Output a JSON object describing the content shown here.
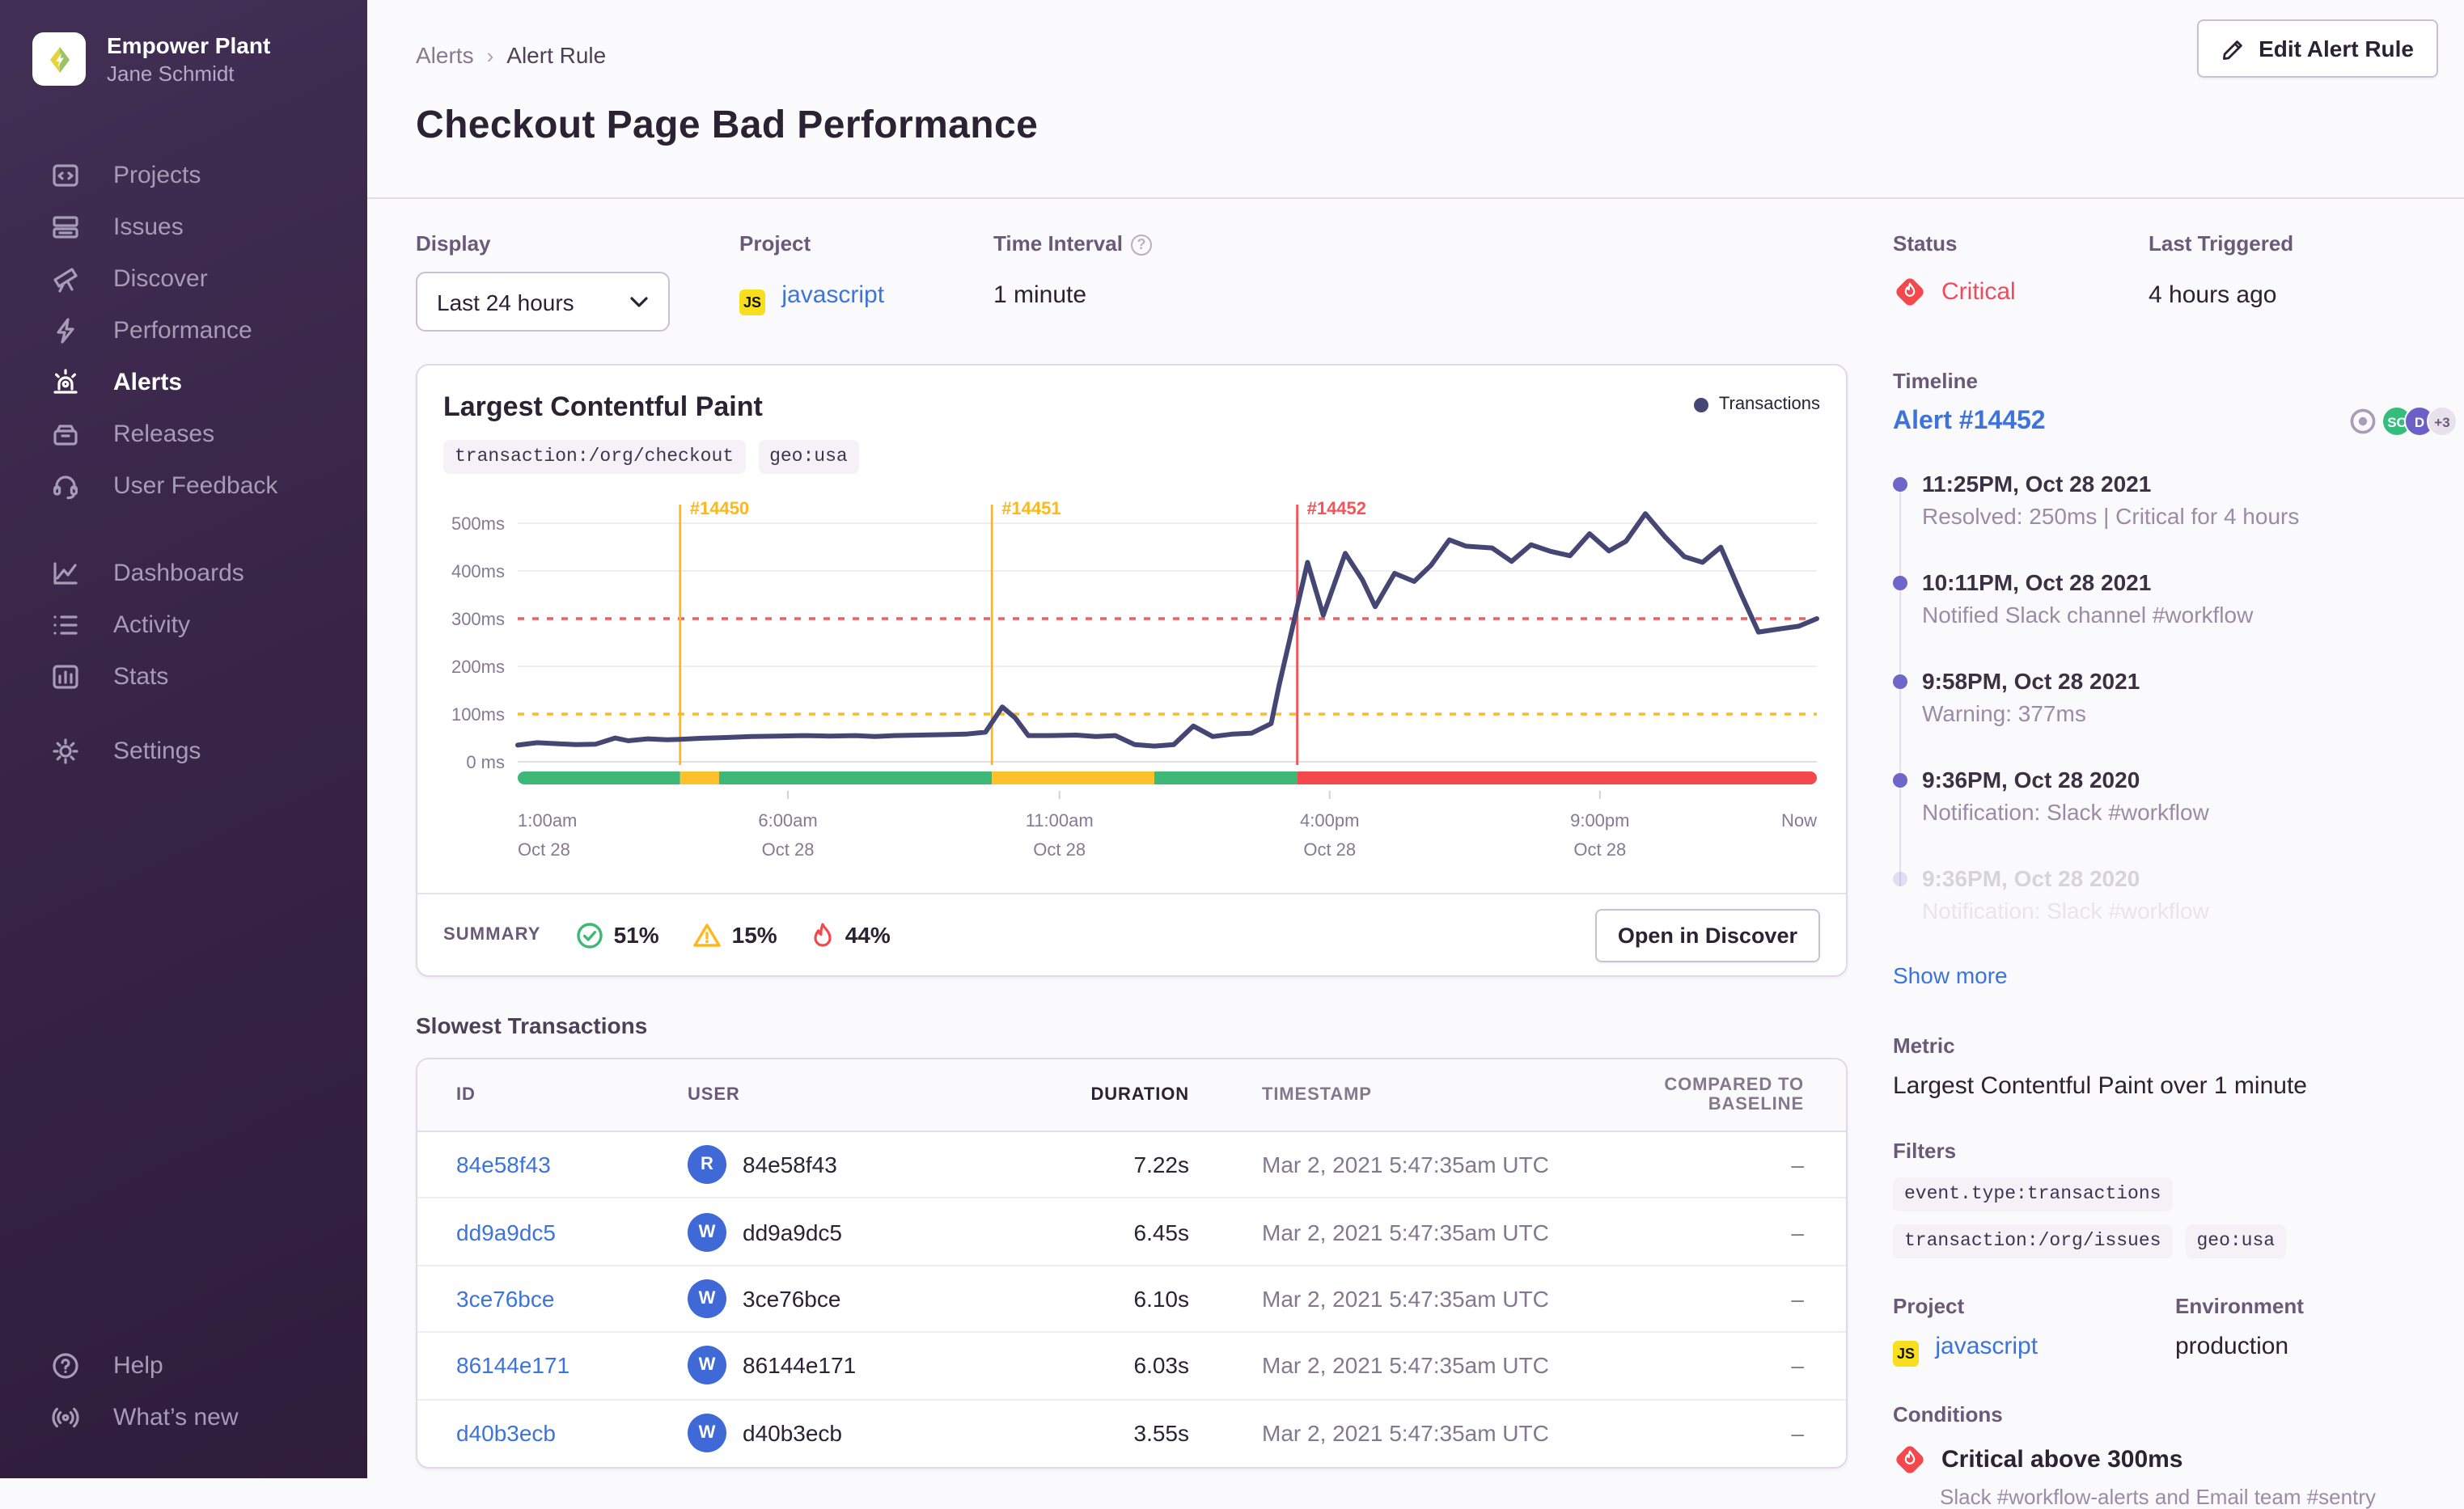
{
  "colors": {
    "critical": "#f5484d",
    "warning": "#fdb81b",
    "ok": "#3eb877",
    "link": "#3d74db",
    "chart_line": "#444674"
  },
  "sidebar": {
    "org_name": "Empower Plant",
    "user_name": "Jane Schmidt",
    "nav": [
      {
        "label": "Projects"
      },
      {
        "label": "Issues"
      },
      {
        "label": "Discover"
      },
      {
        "label": "Performance"
      },
      {
        "label": "Alerts",
        "state": "active"
      },
      {
        "label": "Releases"
      },
      {
        "label": "User Feedback"
      }
    ],
    "nav2": [
      {
        "label": "Dashboards"
      },
      {
        "label": "Activity"
      },
      {
        "label": "Stats"
      }
    ],
    "nav3": [
      {
        "label": "Settings"
      }
    ],
    "footer": [
      {
        "label": "Help"
      },
      {
        "label": "What’s new"
      }
    ]
  },
  "header": {
    "breadcrumb": [
      "Alerts",
      "Alert Rule"
    ],
    "title": "Checkout Page Bad Performance",
    "edit_button": "Edit Alert Rule"
  },
  "meta": {
    "display_label": "Display",
    "display_value": "Last 24 hours",
    "project_label": "Project",
    "project_badge": "JS",
    "project_value": "javascript",
    "interval_label": "Time Interval",
    "interval_value": "1 minute"
  },
  "status_panel": {
    "status_label": "Status",
    "status_value": "Critical",
    "last_triggered_label": "Last Triggered",
    "last_triggered_value": "4 hours ago"
  },
  "chart_card": {
    "summary_label": "SUMMARY",
    "ok_pct": "51%",
    "warn_pct": "15%",
    "crit_pct": "44%",
    "open_discover": "Open in Discover"
  },
  "chart_data": {
    "type": "line",
    "title": "Largest Contentful Paint",
    "filter_tags": [
      "transaction:/org/checkout",
      "geo:usa"
    ],
    "legend": [
      {
        "name": "Transactions",
        "color": "#444674",
        "position": "top-right"
      }
    ],
    "ylim": [
      0,
      560
    ],
    "grid": true,
    "y_ticks": [
      {
        "ms": 500,
        "label": "500ms"
      },
      {
        "ms": 400,
        "label": "400ms"
      },
      {
        "ms": 300,
        "label": "300ms"
      },
      {
        "ms": 200,
        "label": "200ms"
      },
      {
        "ms": 100,
        "label": "100ms"
      },
      {
        "ms": 0,
        "label": "0 ms"
      }
    ],
    "x_ticks": [
      {
        "f": 0,
        "line1": "1:00am",
        "line2": "Oct 28",
        "anchor": "start"
      },
      {
        "f": 20.8,
        "line1": "6:00am",
        "line2": "Oct 28",
        "anchor": "middle"
      },
      {
        "f": 41.7,
        "line1": "11:00am",
        "line2": "Oct 28",
        "anchor": "middle"
      },
      {
        "f": 62.5,
        "line1": "4:00pm",
        "line2": "Oct 28",
        "anchor": "middle"
      },
      {
        "f": 83.3,
        "line1": "9:00pm",
        "line2": "Oct 28",
        "anchor": "middle"
      },
      {
        "f": 100,
        "line1": "Now",
        "line2": "",
        "anchor": "end"
      }
    ],
    "thresholds": [
      {
        "ms": 300,
        "color": "#f55459",
        "label": "critical threshold"
      },
      {
        "ms": 100,
        "color": "#fdb81b",
        "label": "warning threshold"
      }
    ],
    "incidents": [
      {
        "label": "#14450",
        "f": 12.5,
        "color": "#fdb81b"
      },
      {
        "label": "#14451",
        "f": 36.5,
        "color": "#fdb81b"
      },
      {
        "label": "#14452",
        "f": 60,
        "color": "#f55459"
      }
    ],
    "status_strip": [
      {
        "from": 0,
        "to": 12.5,
        "color": "#3eb877"
      },
      {
        "from": 12.5,
        "to": 15.5,
        "color": "#fdc12b"
      },
      {
        "from": 15.5,
        "to": 36.5,
        "color": "#3eb877"
      },
      {
        "from": 36.5,
        "to": 49,
        "color": "#fdc12b"
      },
      {
        "from": 49,
        "to": 60,
        "color": "#3eb877"
      },
      {
        "from": 60,
        "to": 100,
        "color": "#f5484d"
      }
    ],
    "series": [
      {
        "name": "Transactions",
        "color": "#444674",
        "points": [
          [
            0,
            35
          ],
          [
            1.5,
            40
          ],
          [
            3,
            38
          ],
          [
            4.5,
            36
          ],
          [
            6,
            37
          ],
          [
            7.5,
            50
          ],
          [
            8.5,
            44
          ],
          [
            10,
            48
          ],
          [
            11.5,
            46
          ],
          [
            12.5,
            47
          ],
          [
            14,
            49
          ],
          [
            16,
            51
          ],
          [
            18,
            53
          ],
          [
            20,
            54
          ],
          [
            22,
            55
          ],
          [
            24,
            54
          ],
          [
            26,
            55
          ],
          [
            27.5,
            53
          ],
          [
            29,
            55
          ],
          [
            31,
            56
          ],
          [
            33,
            57
          ],
          [
            34.5,
            58
          ],
          [
            36,
            62
          ],
          [
            37.3,
            115
          ],
          [
            38.3,
            92
          ],
          [
            39.3,
            55
          ],
          [
            41,
            55
          ],
          [
            43,
            56
          ],
          [
            44.5,
            53
          ],
          [
            46,
            55
          ],
          [
            47.5,
            36
          ],
          [
            49,
            33
          ],
          [
            50.5,
            36
          ],
          [
            52,
            75
          ],
          [
            53.5,
            53
          ],
          [
            55,
            58
          ],
          [
            56.5,
            60
          ],
          [
            58,
            80
          ],
          [
            58.6,
            160
          ],
          [
            60.8,
            418
          ],
          [
            62,
            307
          ],
          [
            63.7,
            437
          ],
          [
            65,
            382
          ],
          [
            66,
            325
          ],
          [
            67.5,
            395
          ],
          [
            69,
            378
          ],
          [
            70.3,
            412
          ],
          [
            71.7,
            465
          ],
          [
            73,
            452
          ],
          [
            75,
            448
          ],
          [
            76.5,
            420
          ],
          [
            78,
            455
          ],
          [
            79.5,
            441
          ],
          [
            81,
            432
          ],
          [
            82.5,
            478
          ],
          [
            84,
            442
          ],
          [
            85.3,
            462
          ],
          [
            86.8,
            520
          ],
          [
            88.3,
            472
          ],
          [
            89.8,
            430
          ],
          [
            91.2,
            418
          ],
          [
            92.6,
            450
          ],
          [
            94.2,
            350
          ],
          [
            95.5,
            272
          ],
          [
            97,
            278
          ],
          [
            98.6,
            284
          ],
          [
            100,
            300
          ]
        ]
      }
    ]
  },
  "transactions": {
    "title": "Slowest Transactions",
    "headers": [
      "ID",
      "USER",
      "DURATION",
      "TIMESTAMP",
      "COMPARED TO BASELINE"
    ],
    "rows": [
      {
        "id": "84e58f43",
        "avatar": "R",
        "user": "84e58f43",
        "duration": "7.22s",
        "timestamp": "Mar 2, 2021 5:47:35am UTC",
        "baseline": "–"
      },
      {
        "id": "dd9a9dc5",
        "avatar": "W",
        "user": "dd9a9dc5",
        "duration": "6.45s",
        "timestamp": "Mar 2, 2021 5:47:35am UTC",
        "baseline": "–"
      },
      {
        "id": "3ce76bce",
        "avatar": "W",
        "user": "3ce76bce",
        "duration": "6.10s",
        "timestamp": "Mar 2, 2021 5:47:35am UTC",
        "baseline": "–"
      },
      {
        "id": "86144e171",
        "avatar": "W",
        "user": "86144e171",
        "duration": "6.03s",
        "timestamp": "Mar 2, 2021 5:47:35am UTC",
        "baseline": "–"
      },
      {
        "id": "d40b3ecb",
        "avatar": "W",
        "user": "d40b3ecb",
        "duration": "3.55s",
        "timestamp": "Mar 2, 2021 5:47:35am UTC",
        "baseline": "–"
      }
    ]
  },
  "timeline": {
    "label": "Timeline",
    "alert_link": "Alert #14452",
    "avatars": [
      {
        "label": "SC",
        "bg": "#33bf7b"
      },
      {
        "label": "D",
        "bg": "#6c5fc7"
      },
      {
        "label": "+3",
        "bg": "#e7e1ec"
      }
    ],
    "entries": [
      {
        "time": "11:25PM, Oct 28 2021",
        "desc": "Resolved: 250ms | Critical for 4 hours"
      },
      {
        "time": "10:11PM, Oct 28 2021",
        "desc": "Notified Slack channel #workflow"
      },
      {
        "time": "9:58PM, Oct 28 2021",
        "desc": "Warning: 377ms"
      },
      {
        "time": "9:36PM, Oct 28 2020",
        "desc": "Notification: Slack #workflow"
      },
      {
        "time": "9:36PM, Oct 28 2020",
        "desc": "Notification: Slack #workflow",
        "faded": true
      }
    ],
    "show_more": "Show more"
  },
  "details": {
    "metric_label": "Metric",
    "metric_value": "Largest Contentful Paint over 1 minute",
    "filters_label": "Filters",
    "filters": [
      "event.type:transactions",
      "transaction:/org/issues",
      "geo:usa"
    ],
    "project_label": "Project",
    "project_badge": "JS",
    "project_value": "javascript",
    "environment_label": "Environment",
    "environment_value": "production",
    "conditions_label": "Conditions",
    "condition_title": "Critical above 300ms",
    "condition_desc": "Slack #workflow-alerts and Email team #sentry"
  }
}
